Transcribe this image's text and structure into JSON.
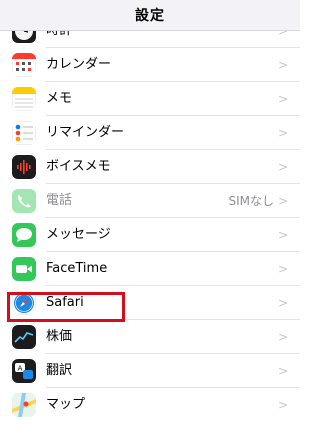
{
  "header": {
    "title": "設定"
  },
  "rows": [
    {
      "id": "clock",
      "label": "時計",
      "icon": "clock-icon"
    },
    {
      "id": "calendar",
      "label": "カレンダー",
      "icon": "calendar-icon"
    },
    {
      "id": "notes",
      "label": "メモ",
      "icon": "notes-icon"
    },
    {
      "id": "reminders",
      "label": "リマインダー",
      "icon": "reminders-icon"
    },
    {
      "id": "voicememo",
      "label": "ボイスメモ",
      "icon": "voice-memo-icon"
    },
    {
      "id": "phone",
      "label": "電話",
      "value": "SIMなし",
      "icon": "phone-icon",
      "disabled": true
    },
    {
      "id": "messages",
      "label": "メッセージ",
      "icon": "messages-icon"
    },
    {
      "id": "facetime",
      "label": "FaceTime",
      "icon": "facetime-icon"
    },
    {
      "id": "safari",
      "label": "Safari",
      "icon": "safari-icon",
      "highlighted": true
    },
    {
      "id": "stocks",
      "label": "株価",
      "icon": "stocks-icon"
    },
    {
      "id": "translate",
      "label": "翻訳",
      "icon": "translate-icon"
    },
    {
      "id": "maps",
      "label": "マップ",
      "icon": "maps-icon"
    }
  ],
  "colors": {
    "highlight": "#d0101d",
    "messages": "#34c759",
    "facetime": "#34c759",
    "phone": "#34c759",
    "safari": "#1e88e5"
  }
}
